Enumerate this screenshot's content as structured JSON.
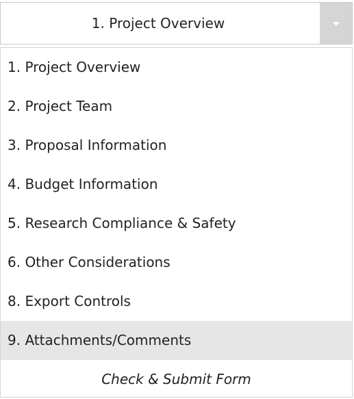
{
  "select": {
    "current_value": "1. Project Overview",
    "button_icon": "chevron-down-icon"
  },
  "menu": {
    "items": [
      {
        "label": "1. Project Overview",
        "selected": false
      },
      {
        "label": "2. Project Team",
        "selected": false
      },
      {
        "label": "3. Proposal Information",
        "selected": false
      },
      {
        "label": "4. Budget Information",
        "selected": false
      },
      {
        "label": "5. Research Compliance & Safety",
        "selected": false
      },
      {
        "label": "6. Other Considerations",
        "selected": false
      },
      {
        "label": "8. Export Controls",
        "selected": false
      },
      {
        "label": "9. Attachments/Comments",
        "selected": true
      },
      {
        "label": "Check & Submit Form",
        "selected": false
      }
    ]
  },
  "colors": {
    "header_border": "#c8c8c8",
    "button_bg": "#d5d5d5",
    "selected_bg": "#e6e6e6",
    "text": "#222222"
  }
}
